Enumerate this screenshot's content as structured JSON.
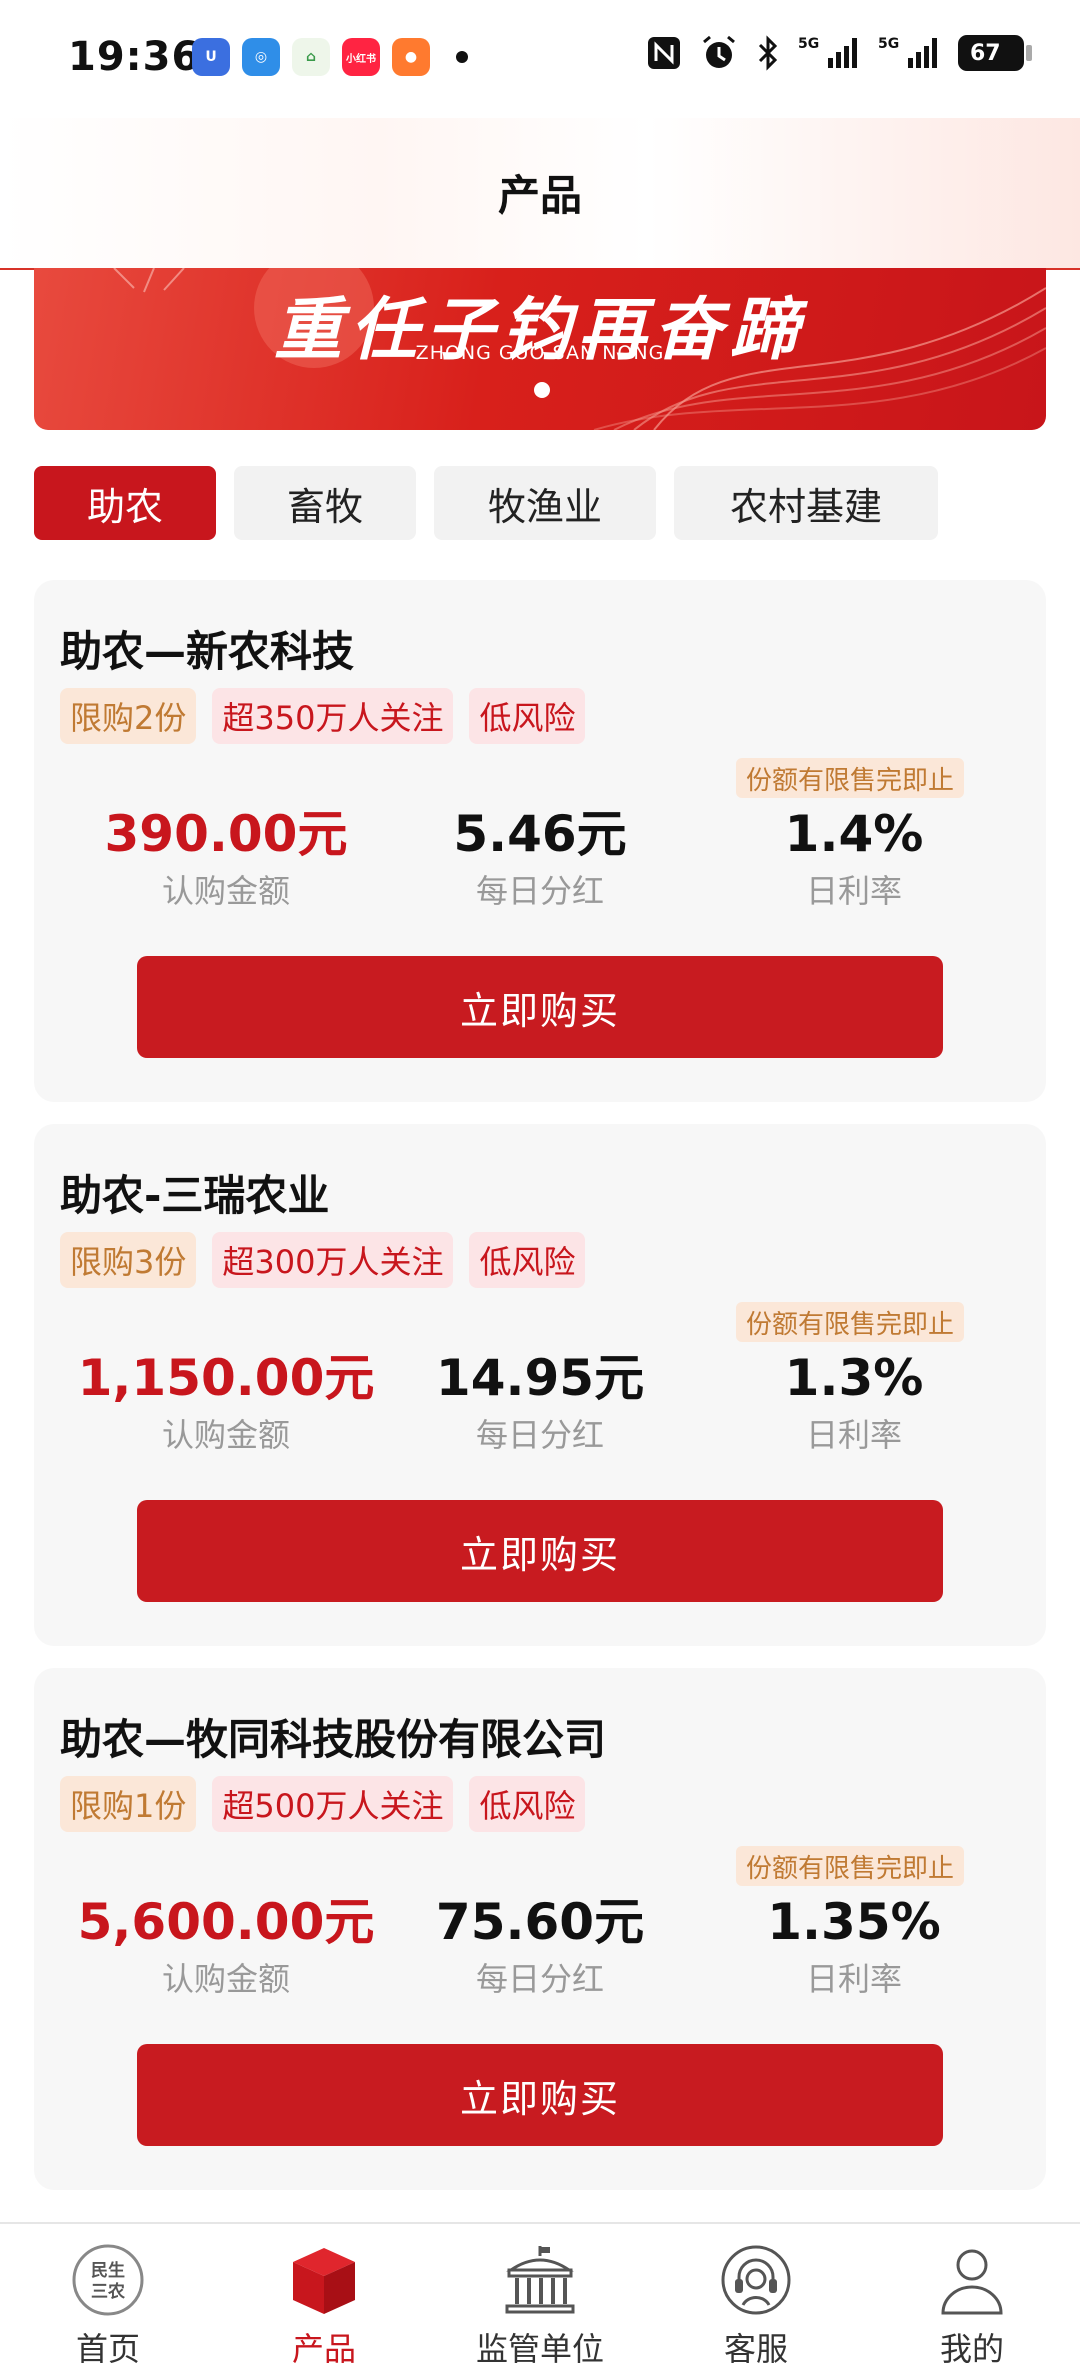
{
  "status_bar": {
    "time": "19:36",
    "notif_icons": [
      {
        "name": "app-u-icon",
        "color": "#3b6fe0",
        "glyph": "U"
      },
      {
        "name": "app-camera-icon",
        "color": "#2f8ee8",
        "glyph": "◎"
      },
      {
        "name": "app-home-icon",
        "color": "#f5f5f5",
        "glyph": "⌂"
      },
      {
        "name": "xiaohongshu-icon",
        "color": "#ff2442",
        "glyph": "小红书"
      },
      {
        "name": "app-orange-icon",
        "color": "#ff7a2f",
        "glyph": "●"
      }
    ],
    "battery": "67"
  },
  "header": {
    "title": "产品"
  },
  "banner": {
    "calligraphy": "重任子钧再奋蹄",
    "subtitle": "ZHONG GUO SAN NONG"
  },
  "tabs": [
    {
      "label": "助农",
      "active": true
    },
    {
      "label": "畜牧",
      "active": false
    },
    {
      "label": "牧渔业",
      "active": false
    },
    {
      "label": "农村基建",
      "active": false
    }
  ],
  "products": [
    {
      "title": "助农—新农科技",
      "tags": {
        "limit": "限购2份",
        "follow": "超350万人关注",
        "risk": "低风险"
      },
      "quota_note": "份额有限售完即止",
      "amount": "390.00元",
      "amount_label": "认购金额",
      "dividend": "5.46元",
      "dividend_label": "每日分红",
      "rate": "1.4%",
      "rate_label": "日利率",
      "button": "立即购买"
    },
    {
      "title": "助农-三瑞农业",
      "tags": {
        "limit": "限购3份",
        "follow": "超300万人关注",
        "risk": "低风险"
      },
      "quota_note": "份额有限售完即止",
      "amount": "1,150.00元",
      "amount_label": "认购金额",
      "dividend": "14.95元",
      "dividend_label": "每日分红",
      "rate": "1.3%",
      "rate_label": "日利率",
      "button": "立即购买"
    },
    {
      "title": "助农—牧同科技股份有限公司",
      "tags": {
        "limit": "限购1份",
        "follow": "超500万人关注",
        "risk": "低风险"
      },
      "quota_note": "份额有限售完即止",
      "amount": "5,600.00元",
      "amount_label": "认购金额",
      "dividend": "75.60元",
      "dividend_label": "每日分红",
      "rate": "1.35%",
      "rate_label": "日利率",
      "button": "立即购买"
    }
  ],
  "bottom_nav": {
    "items": [
      {
        "label": "首页",
        "icon": "minsheng-sannong-logo-icon",
        "logo_text": "民生三农"
      },
      {
        "label": "产品",
        "icon": "cube-icon",
        "active": true
      },
      {
        "label": "监管单位",
        "icon": "government-building-icon"
      },
      {
        "label": "客服",
        "icon": "headset-icon"
      },
      {
        "label": "我的",
        "icon": "user-icon"
      }
    ]
  },
  "colors": {
    "accent": "#c8161d",
    "tag_orange": "#c07a33",
    "muted": "#999999"
  }
}
